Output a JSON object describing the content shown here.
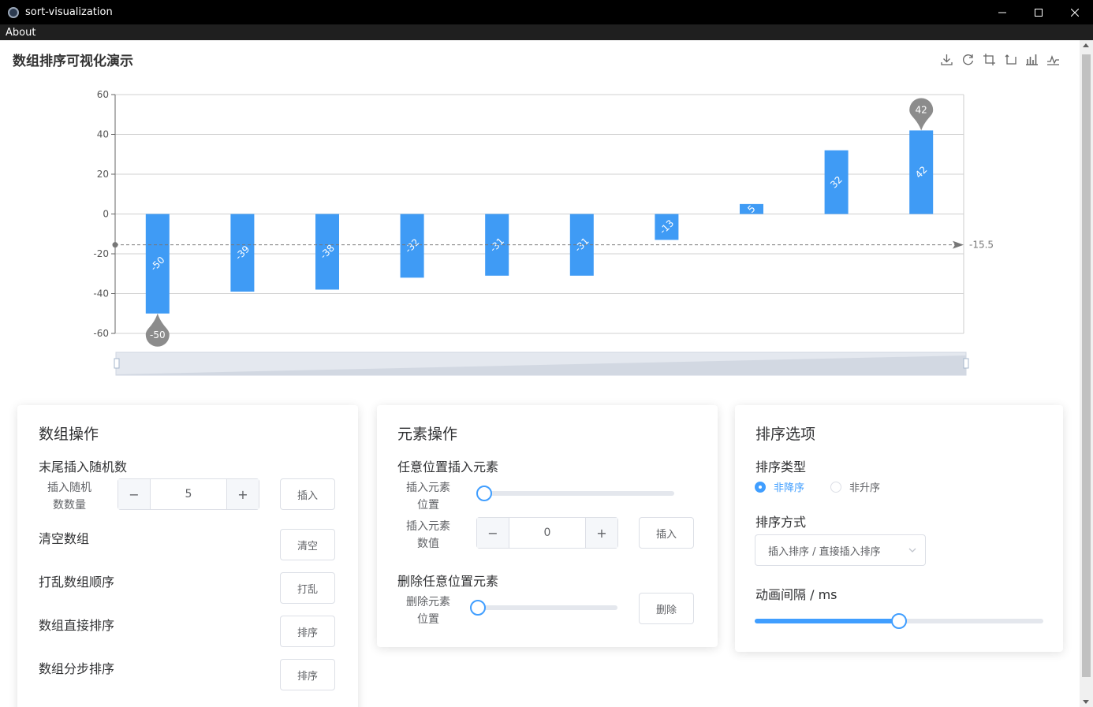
{
  "window": {
    "title": "sort-visualization"
  },
  "menu": {
    "about": "About"
  },
  "chart": {
    "title": "数组排序可视化演示",
    "toolbox": [
      "download-icon",
      "restore-icon",
      "zoom-icon",
      "zoom-reset-icon",
      "bar-chart-icon",
      "line-chart-icon"
    ]
  },
  "chart_data": {
    "type": "bar",
    "values": [
      -50,
      -39,
      -38,
      -32,
      -31,
      -31,
      -13,
      5,
      32,
      42
    ],
    "ylim": [
      -60,
      60
    ],
    "yticks": [
      60,
      40,
      20,
      0,
      -20,
      -40,
      -60
    ],
    "mean": -15.5,
    "mean_label": "-15.5",
    "max_label": "42",
    "min_label": "-50",
    "bar_color": "#3f9bf5",
    "grid": true
  },
  "array_ops": {
    "title": "数组操作",
    "append_random": "末尾插入随机数",
    "count_label_1": "插入随机",
    "count_label_2": "数数量",
    "count_value": "5",
    "insert_btn": "插入",
    "clear_label": "清空数组",
    "clear_btn": "清空",
    "shuffle_label": "打乱数组顺序",
    "shuffle_btn": "打乱",
    "sort_direct_label": "数组直接排序",
    "sort_direct_btn": "排序",
    "sort_step_label": "数组分步排序",
    "sort_step_btn": "排序"
  },
  "element_ops": {
    "title": "元素操作",
    "insert_any": "任意位置插入元素",
    "pos_label_1": "插入元素",
    "pos_label_2": "位置",
    "val_label_1": "插入元素",
    "val_label_2": "数值",
    "val_value": "0",
    "insert_btn": "插入",
    "delete_any": "删除任意位置元素",
    "del_label_1": "删除元素",
    "del_label_2": "位置",
    "delete_btn": "删除"
  },
  "sort_opts": {
    "title": "排序选项",
    "type_label": "排序类型",
    "asc": "非降序",
    "desc": "非升序",
    "method_label": "排序方式",
    "method_value": "插入排序 / 直接插入排序",
    "interval_label": "动画间隔 / ms",
    "interval_fraction": 0.5
  },
  "colors": {
    "accent": "#409eff",
    "marker": "#8c8c8c"
  }
}
